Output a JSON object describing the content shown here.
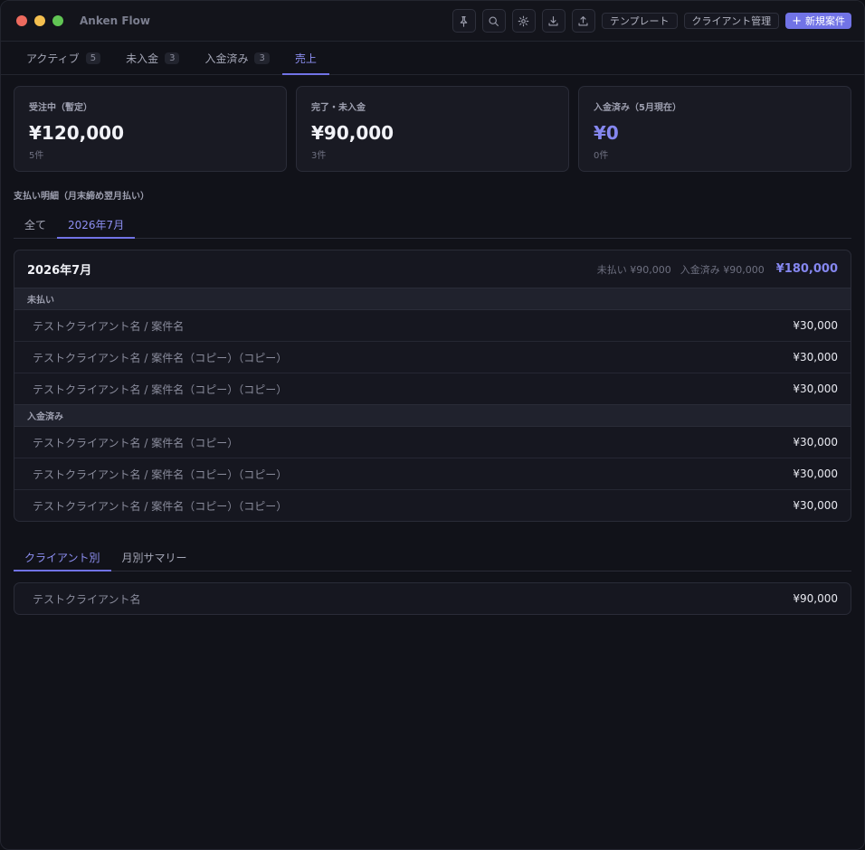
{
  "app": {
    "title": "Anken Flow"
  },
  "toolbar": {
    "icons": [
      "pin-icon",
      "search-icon",
      "gear-icon",
      "download-icon",
      "upload-icon"
    ],
    "template_label": "テンプレート",
    "client_mgmt_label": "クライアント管理",
    "new_case_label": "新規案件",
    "new_case_icon": "+"
  },
  "tabs": [
    {
      "label": "アクティブ",
      "count": "5"
    },
    {
      "label": "未入金",
      "count": "3"
    },
    {
      "label": "入金済み",
      "count": "3"
    },
    {
      "label": "売上",
      "count": ""
    }
  ],
  "active_tab": 3,
  "cards": [
    {
      "label": "受注中（暫定）",
      "value": "¥120,000",
      "sub": "5件"
    },
    {
      "label": "完了・未入金",
      "value": "¥90,000",
      "sub": "3件"
    },
    {
      "label": "入金済み（5月現在）",
      "value": "¥0",
      "sub": "0件"
    }
  ],
  "payment_section": {
    "title": "支払い明細（月末締め翌月払い）",
    "tabs": [
      "全て",
      "2026年7月"
    ],
    "active_tab": 1
  },
  "month": {
    "title": "2026年7月",
    "unpaid_summary": "未払い ¥90,000",
    "paid_summary": "入金済み ¥90,000",
    "total": "¥180,000",
    "groups": [
      {
        "label": "未払い",
        "rows": [
          {
            "name": "テストクライアント名 / 案件名",
            "amount": "¥30,000"
          },
          {
            "name": "テストクライアント名 / 案件名（コピー）（コピー）",
            "amount": "¥30,000"
          },
          {
            "name": "テストクライアント名 / 案件名（コピー）（コピー）",
            "amount": "¥30,000"
          }
        ]
      },
      {
        "label": "入金済み",
        "rows": [
          {
            "name": "テストクライアント名 / 案件名（コピー）",
            "amount": "¥30,000"
          },
          {
            "name": "テストクライアント名 / 案件名（コピー）（コピー）",
            "amount": "¥30,000"
          },
          {
            "name": "テストクライアント名 / 案件名（コピー）（コピー）",
            "amount": "¥30,000"
          }
        ]
      }
    ]
  },
  "bottom_tabs": [
    "クライアント別",
    "月別サマリー"
  ],
  "bottom_active_tab": 0,
  "clients": [
    {
      "name": "テストクライアント名",
      "amount": "¥90,000"
    }
  ],
  "colors": {
    "accent": "#7173e6",
    "background": "#111219",
    "card": "#191a23"
  }
}
